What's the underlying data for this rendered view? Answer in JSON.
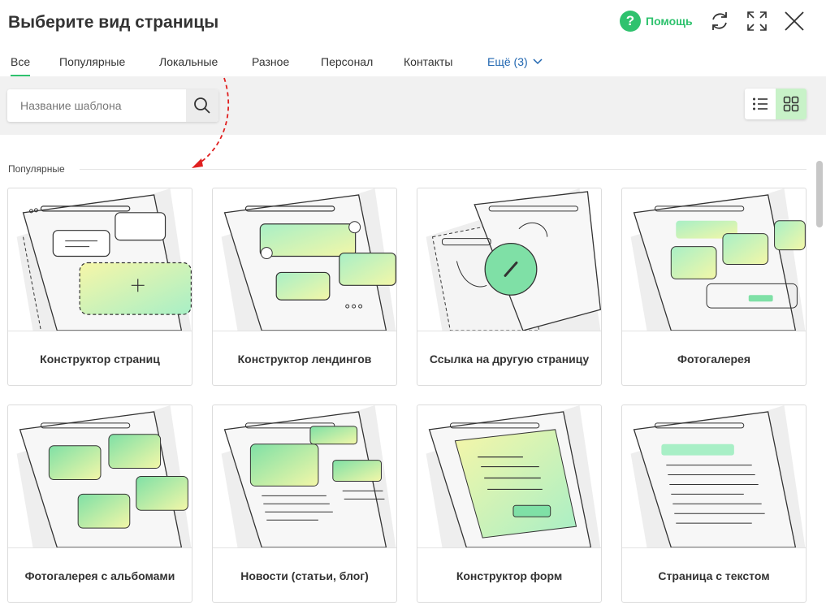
{
  "header": {
    "title": "Выберите вид страницы",
    "help_label": "Помощь",
    "help_symbol": "?"
  },
  "tabs": [
    {
      "label": "Все",
      "active": true
    },
    {
      "label": "Популярные"
    },
    {
      "label": "Локальные"
    },
    {
      "label": "Разное"
    },
    {
      "label": "Персонал"
    },
    {
      "label": "Контакты"
    },
    {
      "label": "Ещё (3)"
    }
  ],
  "search": {
    "placeholder": "Название шаблона"
  },
  "section": {
    "label": "Популярные"
  },
  "cards": [
    {
      "title": "Конструктор страниц"
    },
    {
      "title": "Конструктор лендингов"
    },
    {
      "title": "Ссылка на другую страницу"
    },
    {
      "title": "Фотогалерея"
    },
    {
      "title": "Фотогалерея с альбомами"
    },
    {
      "title": "Новости (статьи, блог)"
    },
    {
      "title": "Конструктор форм"
    },
    {
      "title": "Страница с текстом"
    }
  ],
  "colors": {
    "accent": "#2fc26e",
    "link": "#2066b0",
    "active_view": "#c8f2c8"
  },
  "icons": [
    "help-icon",
    "refresh-icon",
    "expand-icon",
    "close-icon",
    "chevron-down-icon",
    "search-icon",
    "list-view-icon",
    "grid-view-icon"
  ]
}
